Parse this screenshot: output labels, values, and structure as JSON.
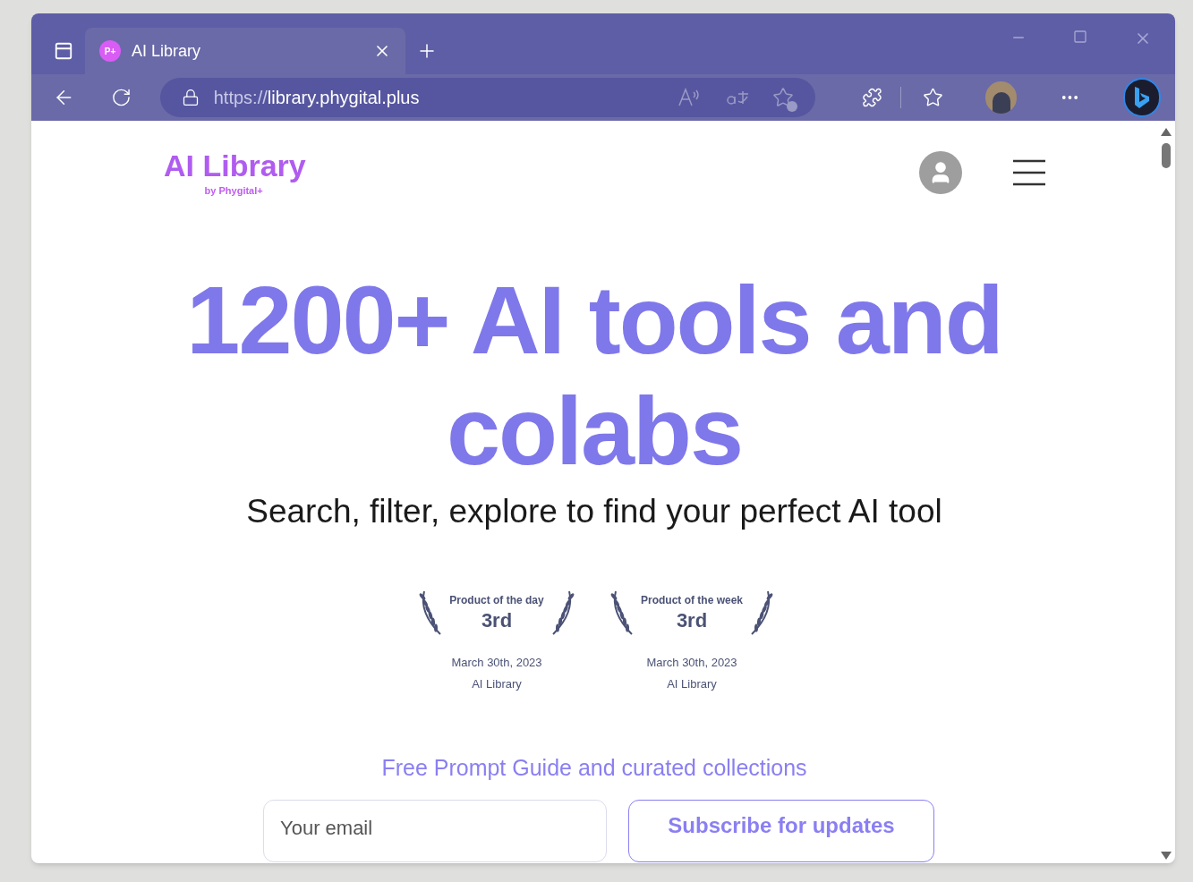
{
  "browser": {
    "tabs": [
      {
        "favicon": "P+",
        "title": "AI Library",
        "selected": true
      }
    ],
    "url_scheme": "https://",
    "url_host": "library.phygital.plus"
  },
  "header": {
    "logo": "AI Library",
    "logo_sub": "by Phygital+"
  },
  "hero": {
    "title": "1200+ AI tools and colabs",
    "subtitle": "Search, filter, explore to find your perfect AI tool"
  },
  "awards": [
    {
      "label": "Product of the day",
      "rank": "3rd",
      "date": "March 30th, 2023",
      "product": "AI Library"
    },
    {
      "label": "Product of the week",
      "rank": "3rd",
      "date": "March 30th, 2023",
      "product": "AI Library"
    }
  ],
  "subscribe": {
    "heading": "Free Prompt Guide and curated collections",
    "placeholder": "Your email",
    "button": "Subscribe for updates"
  }
}
